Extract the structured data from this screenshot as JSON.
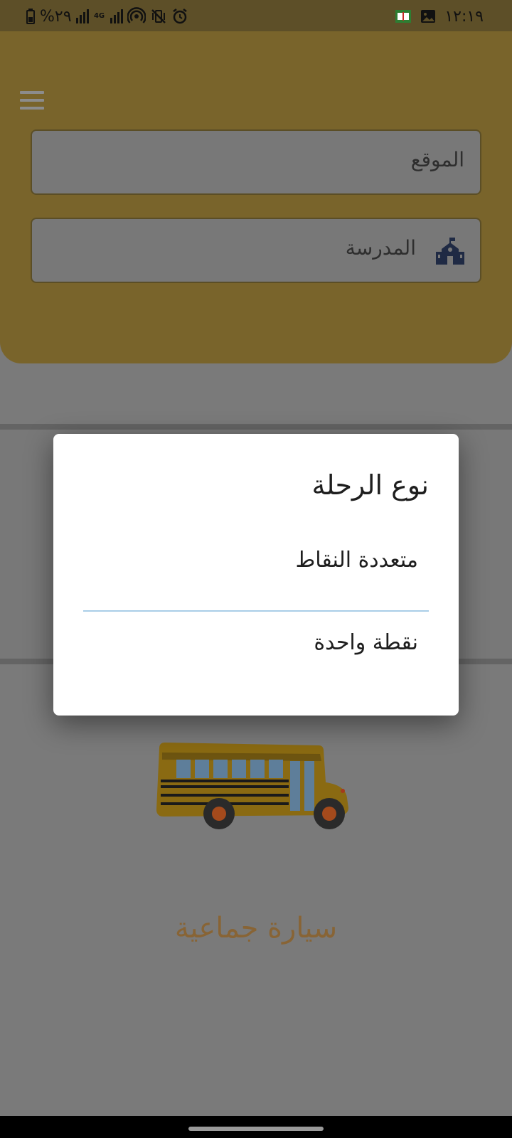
{
  "status_bar": {
    "battery_text": "%٢٩",
    "network_label": "4G",
    "time": "١٢:١٩"
  },
  "header": {
    "menu_icon": "hamburger-icon",
    "location_label": "الموقع",
    "school_label": "المدرسة",
    "school_icon": "school-icon"
  },
  "main": {
    "vehicle_label": "سيارة جماعية",
    "vehicle_icon": "school-bus-illustration"
  },
  "dialog": {
    "title": "نوع الرحلة",
    "options": [
      {
        "label": "متعددة النقاط"
      },
      {
        "label": "نقطة واحدة"
      }
    ]
  },
  "colors": {
    "brand_yellow": "#F2C94C",
    "dialog_bg": "#FFFFFF",
    "separator": "#A9CDE7",
    "vehicle_text": "#886435",
    "school_icon": "#1F2A44"
  }
}
